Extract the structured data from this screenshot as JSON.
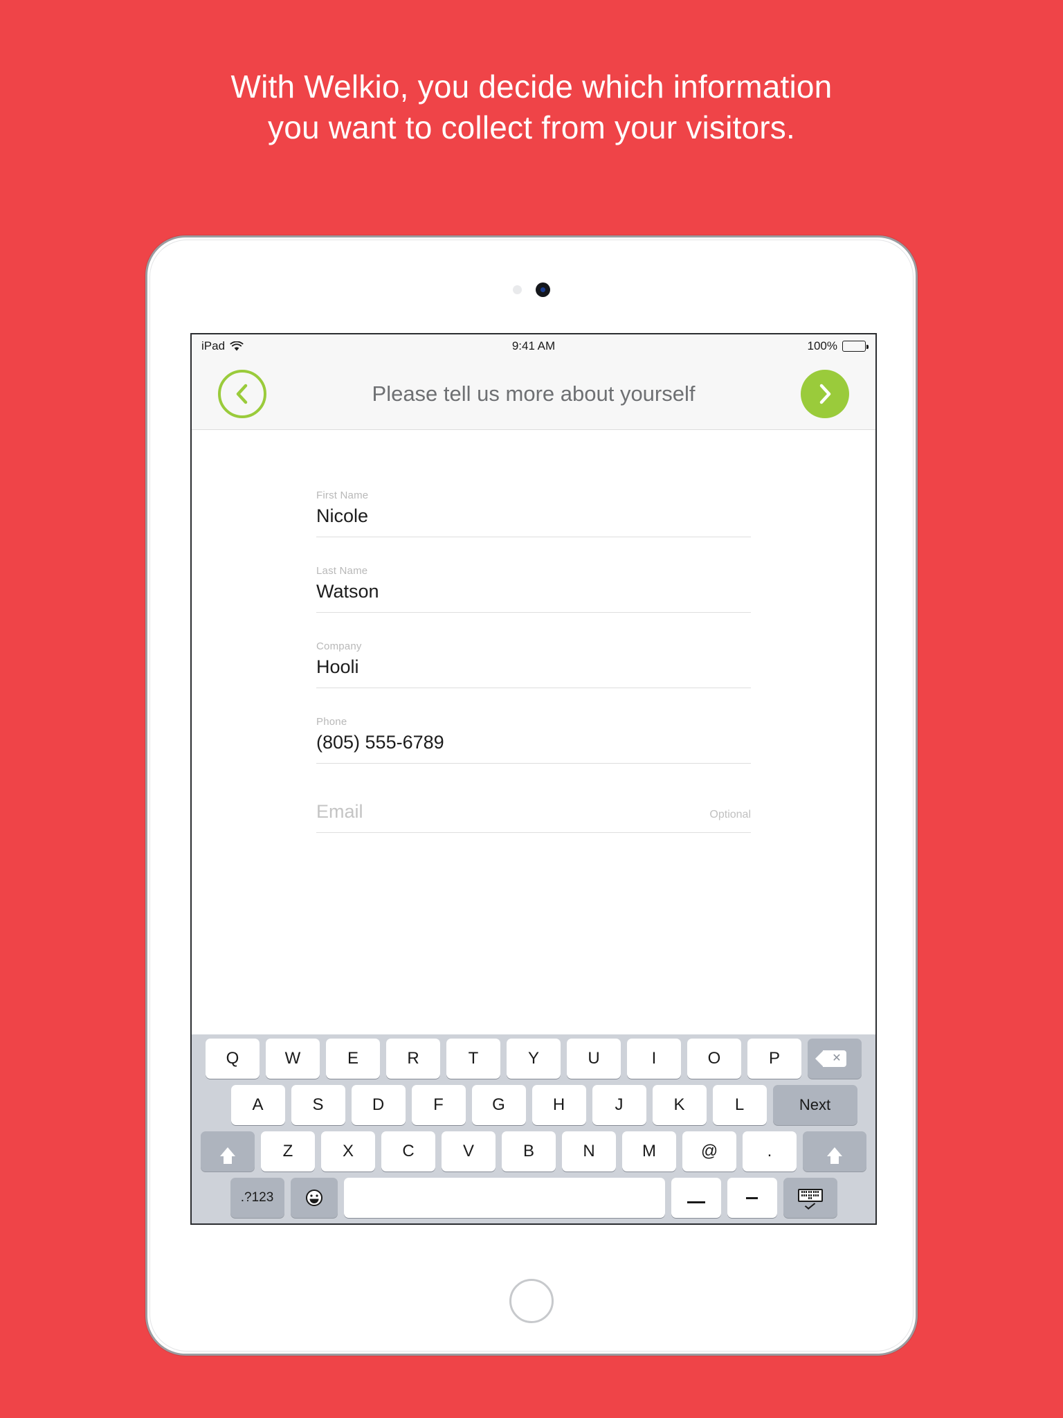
{
  "marketing": {
    "headline_line1": "With Welkio, you decide which information",
    "headline_line2": "you want to collect from your visitors.",
    "background_color": "#ef4448",
    "text_color": "#ffffff"
  },
  "device": {
    "name": "iPad",
    "frame_color": "#ffffff"
  },
  "statusbar": {
    "device_label": "iPad",
    "wifi_icon": "wifi-icon",
    "time": "9:41 AM",
    "battery_percent": "100%",
    "battery_icon": "battery-full-icon"
  },
  "navbar": {
    "title": "Please tell us more about yourself",
    "back_icon": "chevron-left-icon",
    "next_icon": "chevron-right-icon",
    "accent_color": "#9acb3b",
    "title_color": "#6e7073"
  },
  "form": {
    "fields": [
      {
        "label": "First Name",
        "value": "Nicole",
        "placeholder": "",
        "optional": ""
      },
      {
        "label": "Last Name",
        "value": "Watson",
        "placeholder": "",
        "optional": ""
      },
      {
        "label": "Company",
        "value": "Hooli",
        "placeholder": "",
        "optional": ""
      },
      {
        "label": "Phone",
        "value": "(805) 555-6789",
        "placeholder": "",
        "optional": ""
      }
    ],
    "email_field": {
      "label": "",
      "value": "",
      "placeholder": "Email",
      "optional": "Optional"
    }
  },
  "keyboard": {
    "row1": [
      "Q",
      "W",
      "E",
      "R",
      "T",
      "Y",
      "U",
      "I",
      "O",
      "P"
    ],
    "row1_action": {
      "name": "backspace-key",
      "label": ""
    },
    "row2": [
      "A",
      "S",
      "D",
      "F",
      "G",
      "H",
      "J",
      "K",
      "L"
    ],
    "row2_action": {
      "name": "next-key",
      "label": "Next"
    },
    "row3_shift_left": "",
    "row3": [
      "Z",
      "X",
      "C",
      "V",
      "B",
      "N",
      "M",
      "@",
      "."
    ],
    "row3_shift_right": "",
    "row4": {
      "numbers_key": ".?123",
      "emoji_key": "☺",
      "space_key": "",
      "underscore_key": "_",
      "hyphen_key": "-",
      "hide_keyboard_key": ""
    }
  }
}
